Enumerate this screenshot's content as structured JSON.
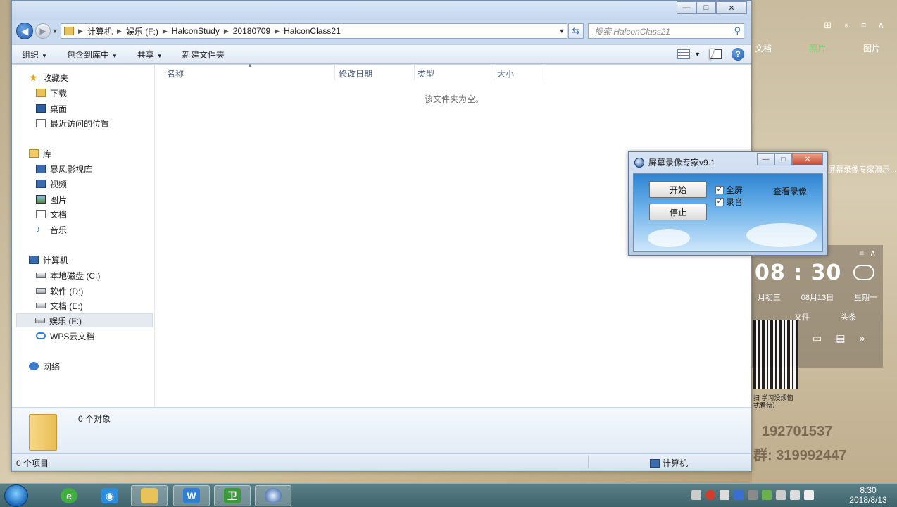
{
  "desktop": {
    "top_icons": [
      "⊞",
      "♁",
      "≡",
      "∧"
    ],
    "links": [
      "文档",
      "照片",
      "图片"
    ],
    "side_text": "屏幕录像专家演示...",
    "widget": {
      "time": "08 : 30",
      "lunar": "月初三",
      "date": "08月13日",
      "weekday": "星期一",
      "file_label": "文件",
      "other_label": "头条"
    },
    "qr_caption": "扫 学习没烦恼\n式看待】",
    "phone1": "192701537",
    "phone2": "群: 319992447"
  },
  "explorer": {
    "window_buttons": {
      "min": "—",
      "max": "□",
      "close": "✕"
    },
    "address": {
      "segments": [
        "计算机",
        "娱乐 (F:)",
        "HalconStudy",
        "20180709",
        "HalconClass21"
      ]
    },
    "search_placeholder": "搜索 HalconClass21",
    "toolbar": {
      "organize": "组织",
      "include_in_library": "包含到库中",
      "share": "共享",
      "new_folder": "新建文件夹"
    },
    "nav": {
      "favorites": "收藏夹",
      "downloads": "下载",
      "desktop": "桌面",
      "recent": "最近访问的位置",
      "libraries": "库",
      "baofeng": "暴风影视库",
      "videos": "视频",
      "pictures": "图片",
      "documents": "文档",
      "music": "音乐",
      "computer": "计算机",
      "drive_c": "本地磁盘 (C:)",
      "drive_d": "软件 (D:)",
      "drive_e": "文档 (E:)",
      "drive_f": "娱乐 (F:)",
      "wps_cloud": "WPS云文档",
      "network": "网络"
    },
    "columns": {
      "name": "名称",
      "modified": "修改日期",
      "type": "类型",
      "size": "大小"
    },
    "empty_message": "该文件夹为空。",
    "details_count": "0 个对象",
    "status_items": "0 个项目",
    "status_location": "计算机"
  },
  "recorder": {
    "title": "屏幕录像专家v9.1",
    "start": "开始",
    "stop": "停止",
    "fullscreen": "全屏",
    "record_audio": "录音",
    "view_recording": "查看录像",
    "fullscreen_checked": true,
    "audio_checked": true
  },
  "taskbar": {
    "time": "8:30",
    "date": "2018/8/13"
  },
  "colors": {
    "window_frame": "#c9d9ee",
    "accent_blue": "#1f5aa8",
    "taskbar": "#4a6f77"
  }
}
